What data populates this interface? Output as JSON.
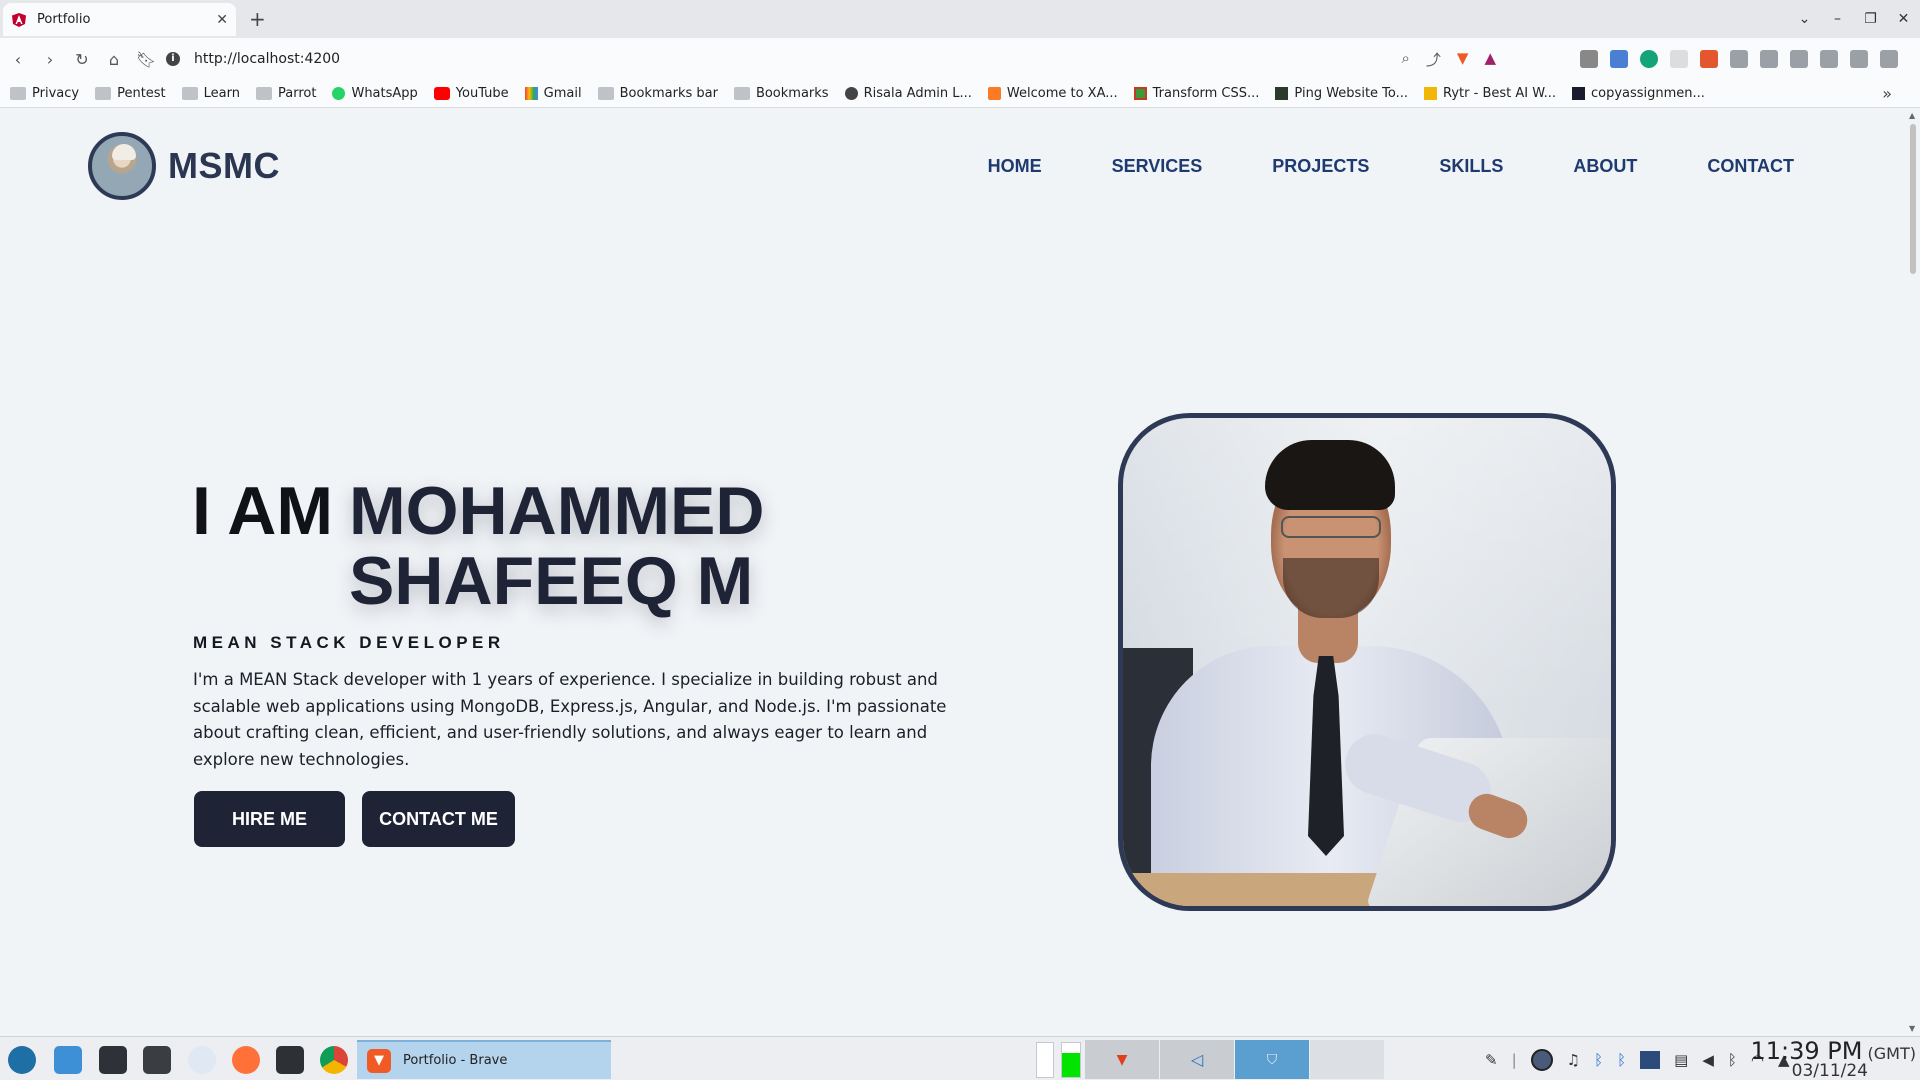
{
  "browser": {
    "tab_title": "Portfolio",
    "new_tab": "+",
    "url": "http://localhost:4200",
    "bookmarks": [
      "Privacy",
      "Pentest",
      "Learn",
      "Parrot",
      "WhatsApp",
      "YouTube",
      "Gmail",
      "Bookmarks bar",
      "Bookmarks",
      "Risala Admin L...",
      "Welcome to XA...",
      "Transform CSS...",
      "Ping Website To...",
      "Rytr - Best AI W...",
      "copyassignmen..."
    ],
    "bookmarks_more": "»"
  },
  "site": {
    "brand": "MSMC",
    "nav": [
      "HOME",
      "SERVICES",
      "PROJECTS",
      "SKILLS",
      "ABOUT",
      "CONTACT"
    ],
    "hero": {
      "prefix": "I AM",
      "name_line1": "MOHAMMED",
      "name_line2": "SHAFEEQ M",
      "role": "MEAN STACK DEVELOPER",
      "bio": "I'm a MEAN Stack developer with 1 years of experience. I specialize in building robust and scalable web applications using MongoDB, Express.js, Angular, and Node.js. I'm passionate about crafting clean, efficient, and user-friendly solutions, and always eager to learn and explore new technologies.",
      "hire_label": "HIRE ME",
      "contact_label": "CONTACT ME"
    }
  },
  "taskbar": {
    "task_label": "Portfolio - Brave",
    "time": "11:39 PM",
    "timezone": "(GMT)",
    "date": "03/11/24"
  },
  "colors": {
    "accent": "#1e2436",
    "nav": "#1e3a6e",
    "background": "#f1f4f7"
  }
}
